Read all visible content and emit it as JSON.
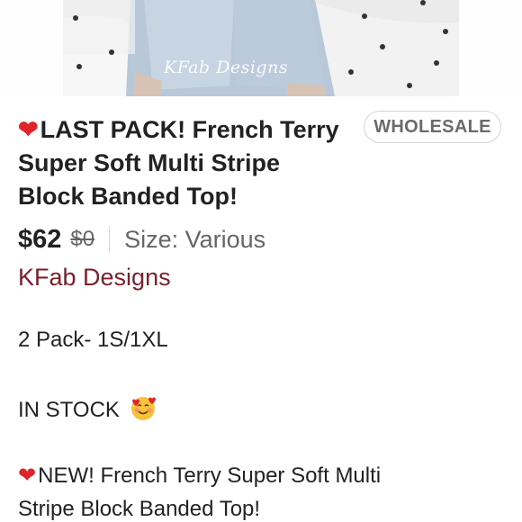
{
  "listing": {
    "watermark": "KFab Designs",
    "title": "LAST PACK! French Terry Super Soft Multi Stripe Block Banded Top!",
    "badge": "WHOLESALE",
    "price": "$62",
    "original_price": "$0",
    "size_label": "Size: Various",
    "brand": "KFab Designs",
    "description": {
      "pack": "2 Pack- 1S/1XL",
      "stock": "IN STOCK",
      "new_line_1": "NEW! French Terry Super Soft Multi",
      "new_line_2": "Stripe Block Banded Top!"
    }
  },
  "icons": {
    "heart": "heart-icon",
    "smile": "smiling-face-with-hearts-icon"
  },
  "colors": {
    "brand": "#7a1f2b",
    "heart": "#e0242c",
    "badge_text": "#6b6b6b"
  }
}
